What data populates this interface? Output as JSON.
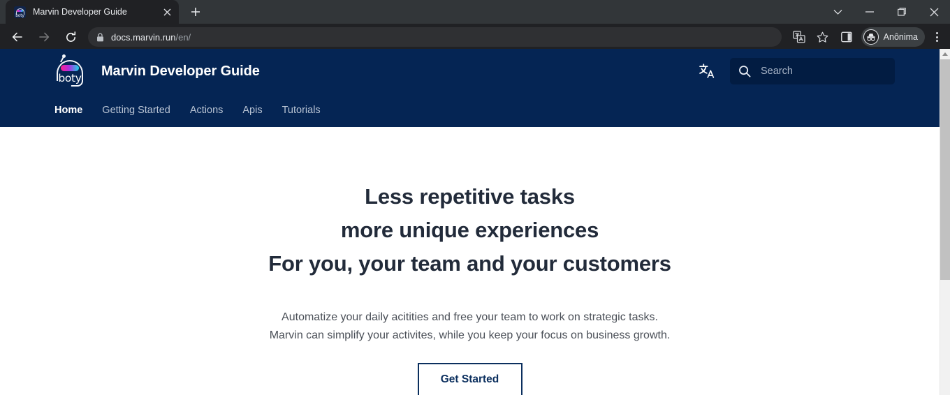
{
  "browser": {
    "tab": {
      "title": "Marvin Developer Guide",
      "favicon_word": "boty",
      "favicon_icon": "boty-logo-icon",
      "close_icon": "close-icon"
    },
    "new_tab_icon": "plus-icon",
    "window_controls": {
      "minimize_tabs_icon": "chevron-down-icon",
      "minimize_icon": "minimize-icon",
      "maximize_icon": "maximize-icon",
      "close_icon": "close-icon"
    },
    "toolbar": {
      "back_icon": "back-arrow-icon",
      "forward_icon": "forward-arrow-icon",
      "reload_icon": "reload-icon",
      "lock_icon": "lock-icon",
      "url_domain": "docs.marvin.run",
      "url_path": "/en/",
      "translate_icon": "translate-page-icon",
      "bookmark_icon": "star-icon",
      "sidepanel_icon": "side-panel-icon",
      "profile_icon": "incognito-avatar-icon",
      "profile_name": "Anônima",
      "menu_icon": "three-dot-menu-icon"
    }
  },
  "site": {
    "logo_word": "boty",
    "logo_icon": "boty-robot-logo-icon",
    "title": "Marvin Developer Guide",
    "translate_icon": "language-translate-icon",
    "search": {
      "icon": "search-icon",
      "placeholder": "Search",
      "value": ""
    },
    "nav": [
      {
        "label": "Home",
        "active": true
      },
      {
        "label": "Getting Started",
        "active": false
      },
      {
        "label": "Actions",
        "active": false
      },
      {
        "label": "Apis",
        "active": false
      },
      {
        "label": "Tutorials",
        "active": false
      }
    ],
    "hero": {
      "headline_line1": "Less repetitive tasks",
      "headline_line2": "more unique experiences",
      "headline_line3": "For you, your team and your customers",
      "paragraph_line1": "Automatize your daily acitities and free your team to work on strategic tasks.",
      "paragraph_line2": "Marvin can simplify your activites, while you keep your focus on business growth.",
      "cta_label": "Get Started"
    }
  },
  "colors": {
    "header_navy": "#052554",
    "search_navy": "#021c42",
    "cta_border": "#0b2f5e",
    "heading_text": "#222b3a",
    "browser_chrome": "#202124",
    "tabstrip": "#323639"
  }
}
